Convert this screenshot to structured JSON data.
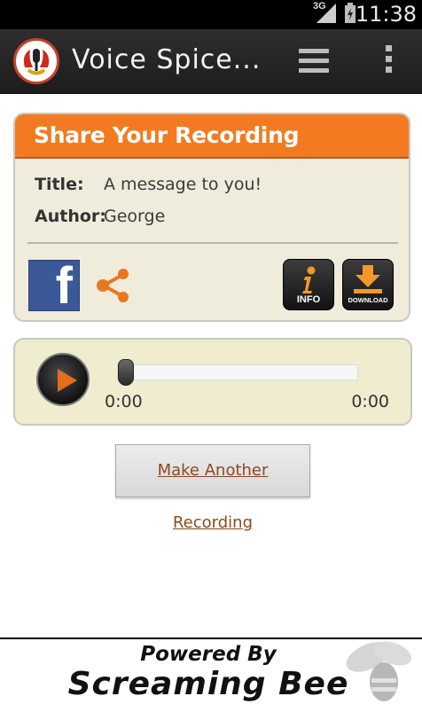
{
  "status_bar": {
    "network": "3G",
    "time": "11:38"
  },
  "action_bar": {
    "app_title": "Voice Spice...",
    "menu_icon": "hamburger-menu-icon",
    "overflow_icon": "overflow-menu-icon"
  },
  "share_card": {
    "header": "Share Your Recording",
    "title_label": "Title:",
    "title_value": "A message to you!",
    "author_label": "Author:",
    "author_value": "George",
    "facebook_glyph": "f",
    "info_label": "INFO",
    "download_label": "DOWNLOAD",
    "accent_color": "#f47a21"
  },
  "player": {
    "current_time": "0:00",
    "duration": "0:00",
    "progress": 0
  },
  "actions": {
    "make_another_label": "Make Another Recording"
  },
  "banner": {
    "powered_by": "Powered By",
    "brand": "Screaming Bee"
  }
}
